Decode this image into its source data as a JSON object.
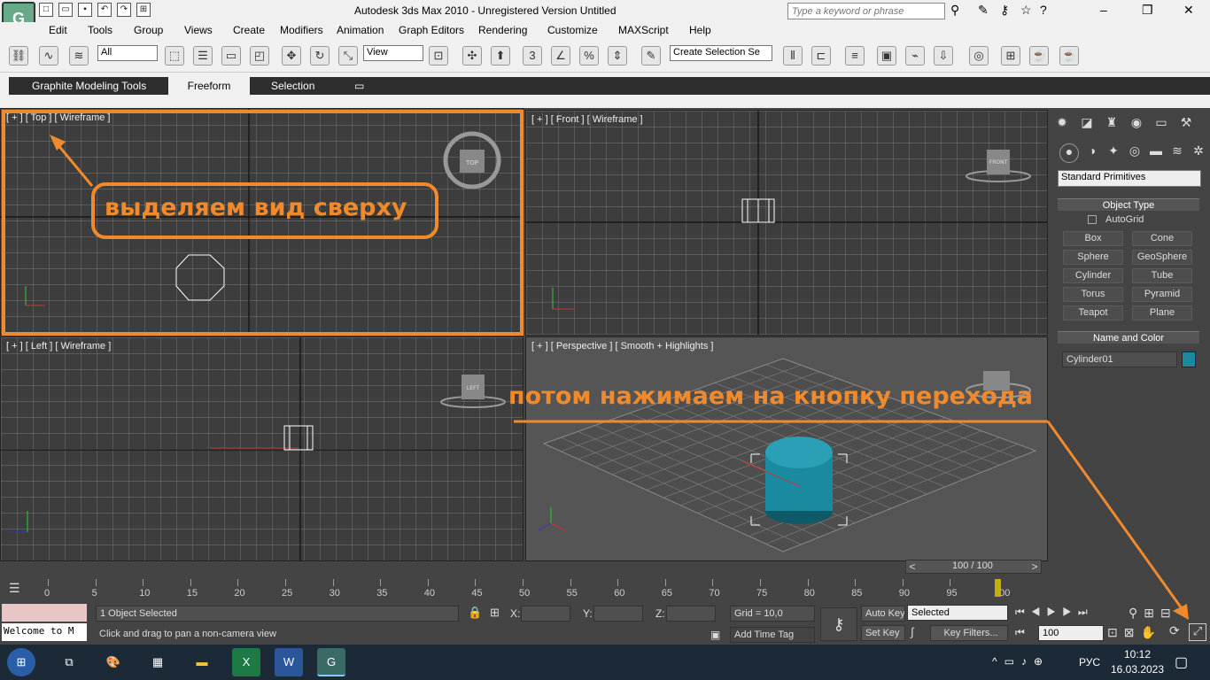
{
  "window": {
    "title": "Autodesk 3ds Max  2010  -  Unregistered Version      Untitled",
    "search_placeholder": "Type a keyword or phrase"
  },
  "menu": [
    "Edit",
    "Tools",
    "Group",
    "Views",
    "Create",
    "Modifiers",
    "Animation",
    "Graph Editors",
    "Rendering",
    "Customize",
    "MAXScript",
    "Help"
  ],
  "toolbar": {
    "filter_value": "All",
    "coord_value": "View",
    "selection_set_value": "Create Selection Se"
  },
  "ribbon": {
    "tabs": [
      "Graphite Modeling Tools",
      "Freeform",
      "Selection"
    ]
  },
  "viewports": {
    "top": {
      "label": "[ + ] [ Top ] [ Wireframe ]",
      "cube": "TOP"
    },
    "front": {
      "label": "[ + ] [ Front ] [ Wireframe ]",
      "cube": "FRONT"
    },
    "left": {
      "label": "[ + ] [ Left ] [ Wireframe ]",
      "cube": "LEFT"
    },
    "perspective": {
      "label": "[ + ] [ Perspective ] [ Smooth + Highlights ]"
    }
  },
  "command_panel": {
    "category": "Standard Primitives",
    "object_type_title": "Object Type",
    "autogrid": "AutoGrid",
    "buttons": [
      "Box",
      "Cone",
      "Sphere",
      "GeoSphere",
      "Cylinder",
      "Tube",
      "Torus",
      "Pyramid",
      "Teapot",
      "Plane"
    ],
    "name_color_title": "Name and Color",
    "object_name": "Cylinder01",
    "object_color": "#1a8aa0"
  },
  "timeline": {
    "slider_label": "100 / 100",
    "ticks": [
      "0",
      "5",
      "10",
      "15",
      "20",
      "25",
      "30",
      "35",
      "40",
      "45",
      "50",
      "55",
      "60",
      "65",
      "70",
      "75",
      "80",
      "85",
      "90",
      "95",
      "100"
    ]
  },
  "status": {
    "maxscript_text": "Welcome to M",
    "selected_text": "1 Object Selected",
    "prompt_text": "Click and drag to pan a non-camera view",
    "x_label": "X:",
    "y_label": "Y:",
    "z_label": "Z:",
    "grid": "Grid = 10,0",
    "add_time_tag": "Add Time Tag",
    "auto_key": "Auto Key",
    "set_key": "Set Key",
    "key_mode": "Selected",
    "key_filters": "Key Filters...",
    "frame": "100"
  },
  "taskbar": {
    "lang": "РУС",
    "time": "10:12",
    "date": "16.03.2023"
  },
  "annotations": {
    "first": "выделяем вид сверху",
    "second": "потом нажимаем на кнопку перехода"
  },
  "colors": {
    "accent_orange": "#f08a2c",
    "cylinder": "#1a8aa0",
    "viewport_bg": "#3d3d3d"
  }
}
